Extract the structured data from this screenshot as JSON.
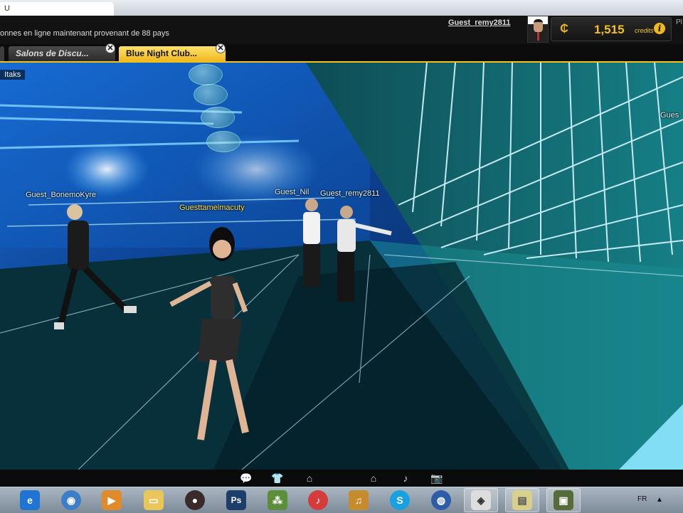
{
  "browser": {
    "tab_title": "U"
  },
  "header": {
    "online_text": "onnes en ligne maintenant provenant de 88 pays",
    "username": "Guest_remy2811",
    "credits_amount": "1,515",
    "credits_label": "credits",
    "edge_text": "Pl"
  },
  "tabs": [
    {
      "label": "Salons de Discu..."
    },
    {
      "label": "Blue Night Club..."
    }
  ],
  "scene": {
    "room_label": "Itaks",
    "bubbles": [
      "",
      "",
      "",
      ""
    ],
    "nametags": [
      {
        "text": "Guest_BonemoKyre"
      },
      {
        "text": "Guesttamelmacuty"
      },
      {
        "text": "Guest_Nil"
      },
      {
        "text": "Guest_remy2811"
      },
      {
        "text": "Gues"
      }
    ]
  },
  "hud_icons": [
    "chat-icon",
    "shirt-icon",
    "hanger-icon",
    "home-icon",
    "music-icon",
    "camera-icon"
  ],
  "taskbar": {
    "language": "FR",
    "icons": [
      "ie-icon",
      "media-center-icon",
      "media-player-icon",
      "folder-icon",
      "game-icon",
      "photoshop-icon",
      "network-icon",
      "itunes-icon",
      "music-note-icon",
      "skype-icon",
      "globe-icon",
      "imvu-icon",
      "notes-icon",
      "camera-app-icon"
    ]
  },
  "colors": {
    "accent": "#f1c21c",
    "credits": "#f4c020"
  }
}
